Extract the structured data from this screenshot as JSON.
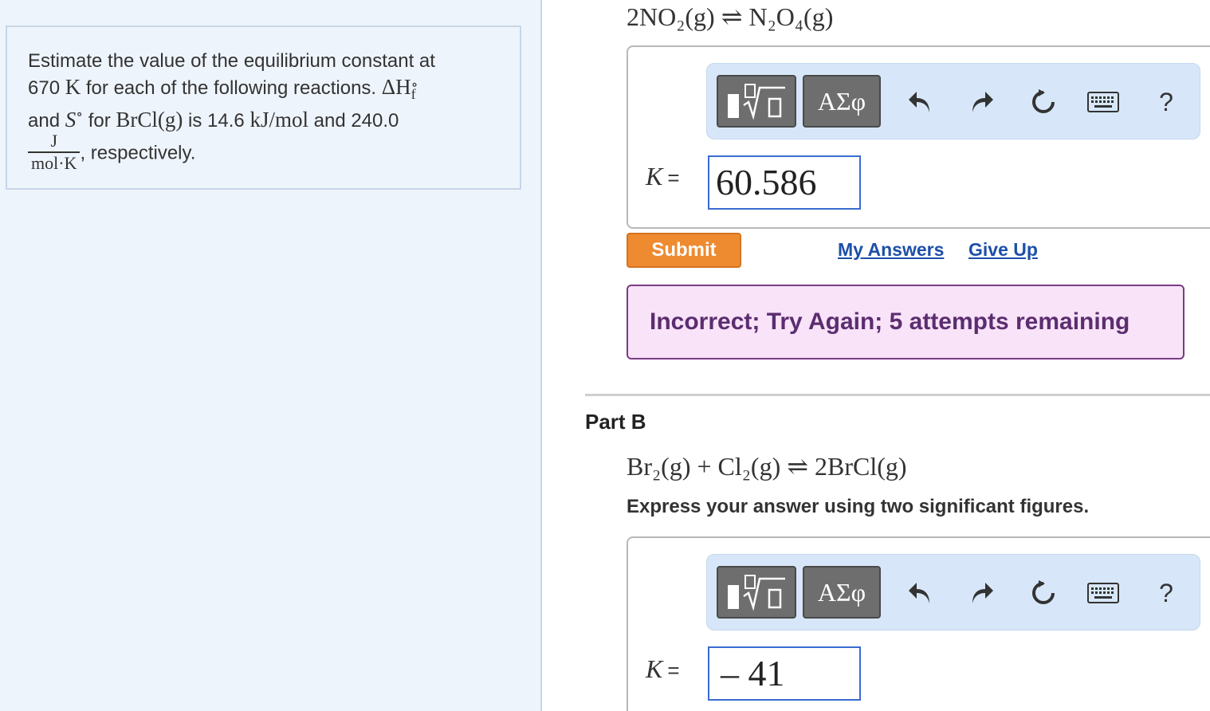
{
  "problem": {
    "line1": "Estimate the value of the equilibrium constant at",
    "temp_value": "670",
    "temp_unit": "K",
    "line2_rest": " for each of the following reactions.",
    "delta_h": "ΔH",
    "delta_h_sub": "f",
    "delta_h_sup": "∘",
    "line3_and": "and ",
    "entropy_symbol": "S",
    "entropy_sup": "∘",
    "line3_for": " for ",
    "compound": "BrCl(g)",
    "line3_is": " is 14.6 ",
    "enthalpy_unit": "kJ/mol",
    "line3_and2": " and 240.0",
    "frac_num": "J",
    "frac_den": "mol·K",
    "line4_rest": ", respectively."
  },
  "part_a": {
    "equation_prefix": "2NO",
    "equation_text": "2NO₂(g) ⇌ N₂O₄(g)",
    "k_label": "K",
    "k_eq": "=",
    "answer_value": "60.586",
    "submit_label": "Submit",
    "my_answers_label": "My Answers",
    "give_up_label": "Give Up",
    "feedback_text": "Incorrect; Try Again; 5 attempts remaining"
  },
  "part_b": {
    "label": "Part B",
    "equation_text": "Br₂(g) + Cl₂(g) ⇌ 2BrCl(g)",
    "instructions": "Express your answer using two significant figures.",
    "k_label": "K",
    "k_eq": "=",
    "answer_value": "– 41"
  },
  "toolbar": {
    "greek_label": "ΑΣφ",
    "help_label": "?",
    "icons": [
      "templates-icon",
      "undo-icon",
      "redo-icon",
      "reset-icon",
      "keyboard-icon",
      "help-icon"
    ]
  },
  "colors": {
    "left_bg": "#eef4fc",
    "toolbar_bg": "#d7e7f9",
    "submit": "#ee8a30",
    "link": "#1d4fa8",
    "feedback_bg": "#f8e3f8",
    "feedback_text": "#5b2d70",
    "input_border": "#3a6bd0"
  }
}
